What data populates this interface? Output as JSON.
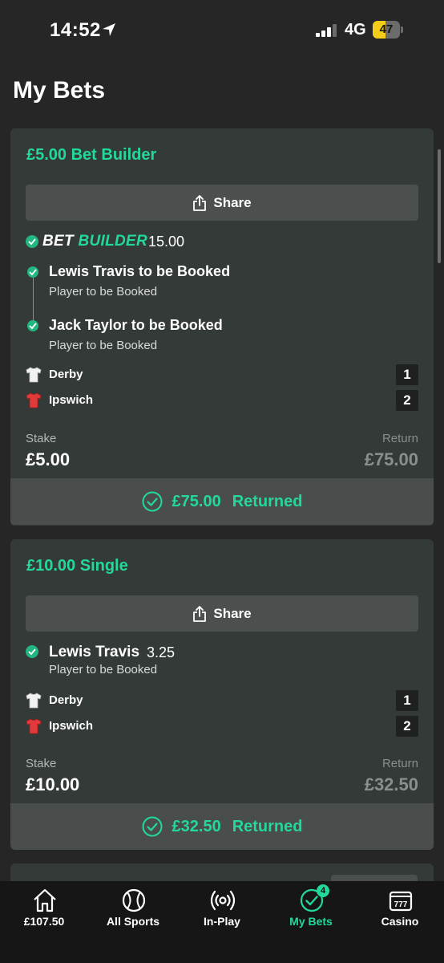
{
  "status_bar": {
    "time": "14:52",
    "network": "4G",
    "battery_percent": "47",
    "battery_level": 0.47,
    "signal_bars_filled": 3
  },
  "page": {
    "title": "My Bets"
  },
  "colors": {
    "accent": "#23d999",
    "background": "#262626",
    "card": "#343a37",
    "nav": "#161616"
  },
  "bets": [
    {
      "title": "£5.00 Bet Builder",
      "share_label": "Share",
      "builder_logo": {
        "part1": "BET",
        "part2": "BUILDER"
      },
      "odds": "15.00",
      "selections": [
        {
          "name": "Lewis Travis to be Booked",
          "market": "Player to be Booked"
        },
        {
          "name": "Jack Taylor to be Booked",
          "market": "Player to be Booked"
        }
      ],
      "teams": [
        {
          "name": "Derby",
          "score": "1",
          "shirt": "white-shirt-icon"
        },
        {
          "name": "Ipswich",
          "score": "2",
          "shirt": "red-shirt-icon"
        }
      ],
      "stake_label": "Stake",
      "stake": "£5.00",
      "return_label": "Return",
      "return": "£75.00",
      "returned_amount": "£75.00",
      "returned_label": "Returned"
    },
    {
      "title": "£10.00 Single",
      "share_label": "Share",
      "selection": {
        "name": "Lewis Travis",
        "odds": "3.25",
        "market": "Player to be Booked"
      },
      "teams": [
        {
          "name": "Derby",
          "score": "1",
          "shirt": "white-shirt-icon"
        },
        {
          "name": "Ipswich",
          "score": "2",
          "shirt": "red-shirt-icon"
        }
      ],
      "stake_label": "Stake",
      "stake": "£10.00",
      "return_label": "Return",
      "return": "£32.50",
      "returned_amount": "£32.50",
      "returned_label": "Returned"
    }
  ],
  "nav": {
    "items": [
      {
        "label": "£107.50",
        "icon": "home-icon"
      },
      {
        "label": "All Sports",
        "icon": "tennis-ball-icon"
      },
      {
        "label": "In-Play",
        "icon": "broadcast-icon"
      },
      {
        "label": "My Bets",
        "icon": "check-circle-icon",
        "badge": "4",
        "active": true
      },
      {
        "label": "Casino",
        "icon": "slot-machine-icon"
      }
    ]
  }
}
